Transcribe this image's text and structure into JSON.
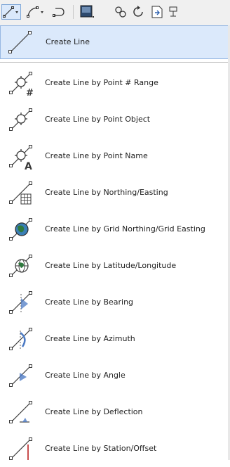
{
  "toolbar": {
    "buttons": [
      {
        "icon": "line-dropdown-icon",
        "active": true
      },
      {
        "icon": "arc-line-dropdown-icon"
      },
      {
        "icon": "curve-icon"
      },
      {
        "icon": "block-icon"
      },
      {
        "icon": "link-icon"
      },
      {
        "icon": "rotate-icon"
      },
      {
        "icon": "edit-document-icon"
      },
      {
        "icon": "more-icon"
      }
    ]
  },
  "menu": {
    "first_item": {
      "label": "Create Line",
      "icon": "create-line-icon"
    },
    "items": [
      {
        "label": "Create Line by Point # Range",
        "icon": "point-range-icon"
      },
      {
        "label": "Create Line by Point Object",
        "icon": "point-object-icon"
      },
      {
        "label": "Create Line by Point Name",
        "icon": "point-name-icon"
      },
      {
        "label": "Create Line by Northing/Easting",
        "icon": "northing-easting-icon"
      },
      {
        "label": "Create Line by Grid Northing/Grid Easting",
        "icon": "grid-northing-easting-icon"
      },
      {
        "label": "Create Line by Latitude/Longitude",
        "icon": "latitude-longitude-icon"
      },
      {
        "label": "Create Line by Bearing",
        "icon": "bearing-icon"
      },
      {
        "label": "Create Line by Azimuth",
        "icon": "azimuth-icon"
      },
      {
        "label": "Create Line by Angle",
        "icon": "angle-icon"
      },
      {
        "label": "Create Line by Deflection",
        "icon": "deflection-icon"
      },
      {
        "label": "Create Line by Station/Offset",
        "icon": "station-offset-icon"
      }
    ]
  },
  "colors": {
    "highlight_bg": "#dbe9fb",
    "highlight_border": "#97b8e3",
    "icon_stroke": "#3a3a3a",
    "globe": "#2f7a3f",
    "blue_accent": "#4d7bc4"
  }
}
